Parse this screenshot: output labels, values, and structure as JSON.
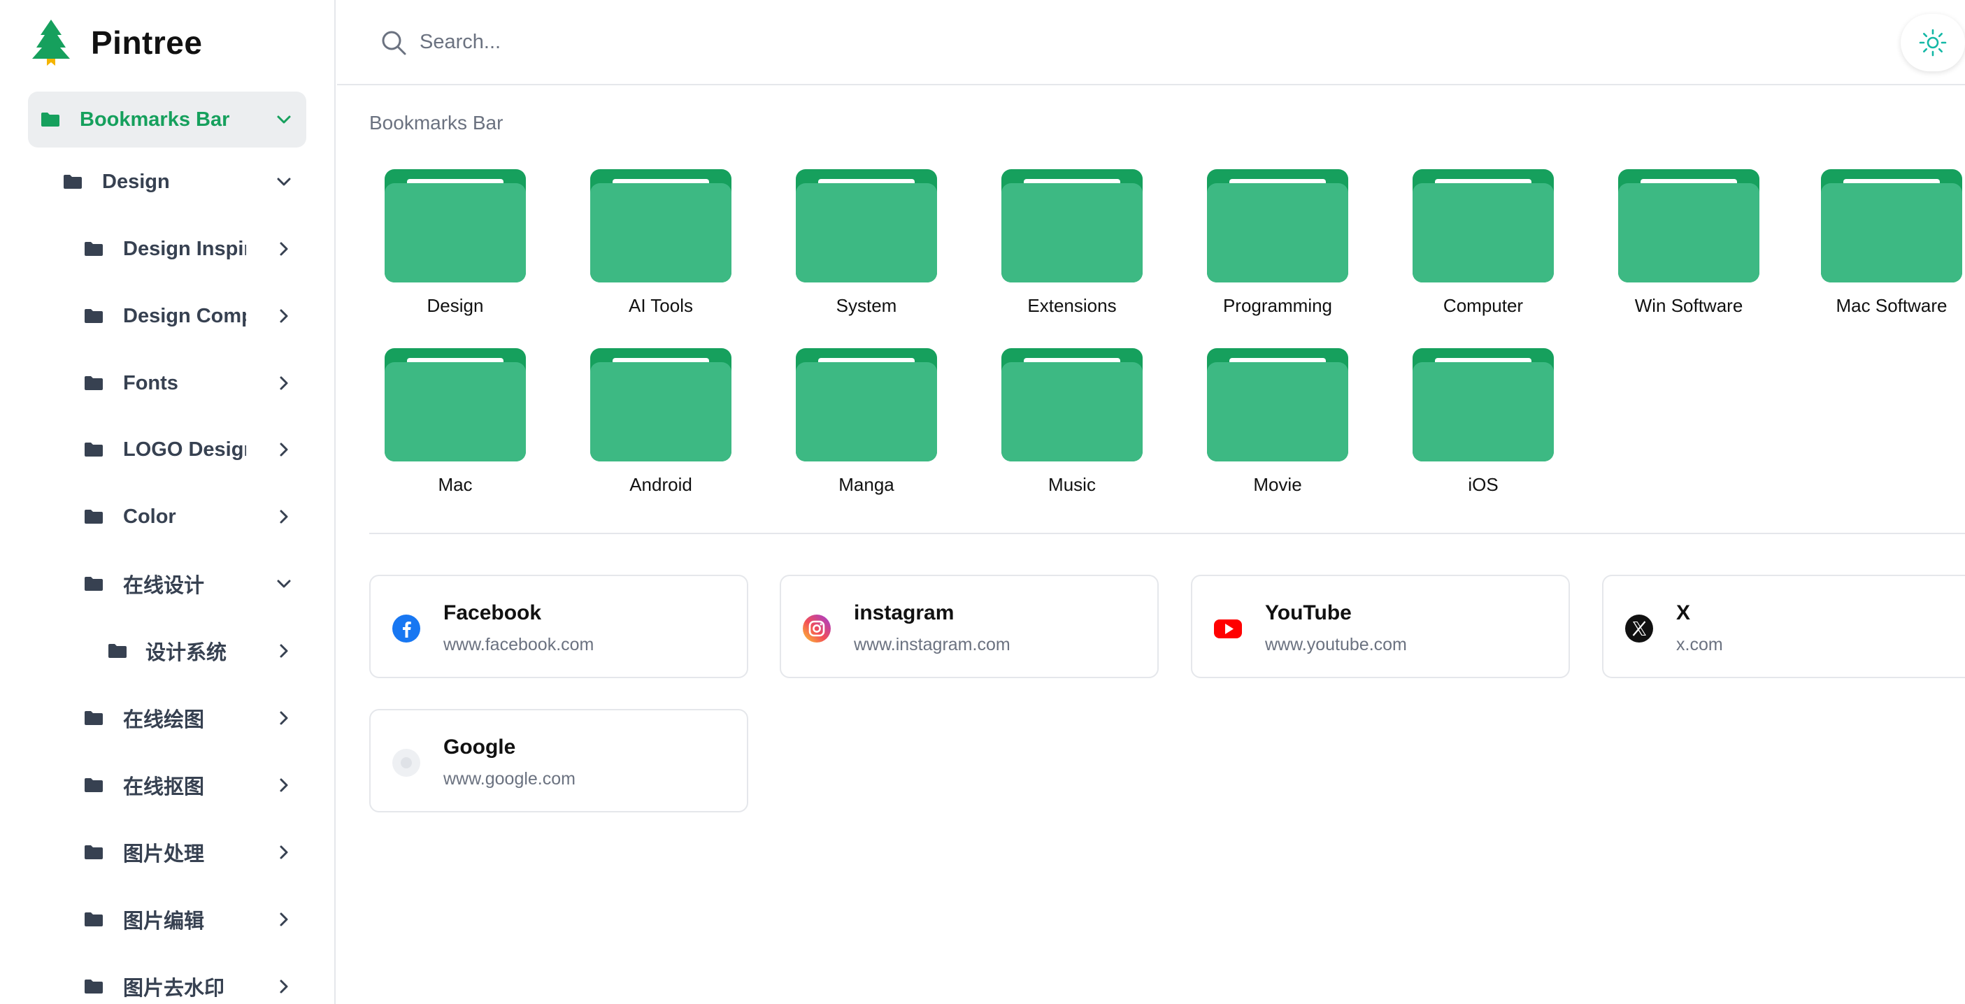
{
  "brand": {
    "name": "Pintree",
    "accent": "#16a05d"
  },
  "search": {
    "placeholder": "Search..."
  },
  "theme_toggle": {
    "icon": "sun-icon"
  },
  "sidebar": {
    "items": [
      {
        "label": "Bookmarks Bar",
        "state": "expanded",
        "active": true
      },
      {
        "label": "Design",
        "state": "expanded"
      },
      {
        "label": "Design Inspir",
        "state": "collapsed"
      },
      {
        "label": "Design Comp",
        "state": "collapsed"
      },
      {
        "label": "Fonts",
        "state": "collapsed"
      },
      {
        "label": "LOGO Design",
        "state": "collapsed"
      },
      {
        "label": "Color",
        "state": "collapsed"
      },
      {
        "label": "在线设计",
        "state": "expanded"
      },
      {
        "label": "设计系统",
        "state": "collapsed"
      },
      {
        "label": "在线绘图",
        "state": "collapsed"
      },
      {
        "label": "在线抠图",
        "state": "collapsed"
      },
      {
        "label": "图片处理",
        "state": "collapsed"
      },
      {
        "label": "图片编辑",
        "state": "collapsed"
      },
      {
        "label": "图片去水印",
        "state": "collapsed"
      }
    ]
  },
  "main": {
    "section_title": "Bookmarks Bar",
    "folders": [
      "Design",
      "AI Tools",
      "System",
      "Extensions",
      "Programming",
      "Computer",
      "Win Software",
      "Mac Software",
      "Mac",
      "Android",
      "Manga",
      "Music",
      "Movie",
      "iOS"
    ],
    "bookmarks": [
      {
        "title": "Facebook",
        "url": "www.facebook.com",
        "icon": "facebook-icon"
      },
      {
        "title": "instagram",
        "url": "www.instagram.com",
        "icon": "instagram-icon"
      },
      {
        "title": "YouTube",
        "url": "www.youtube.com",
        "icon": "youtube-icon"
      },
      {
        "title": "X",
        "url": "x.com",
        "icon": "x-icon"
      },
      {
        "title": "Google",
        "url": "www.google.com",
        "icon": "google-icon"
      }
    ]
  }
}
